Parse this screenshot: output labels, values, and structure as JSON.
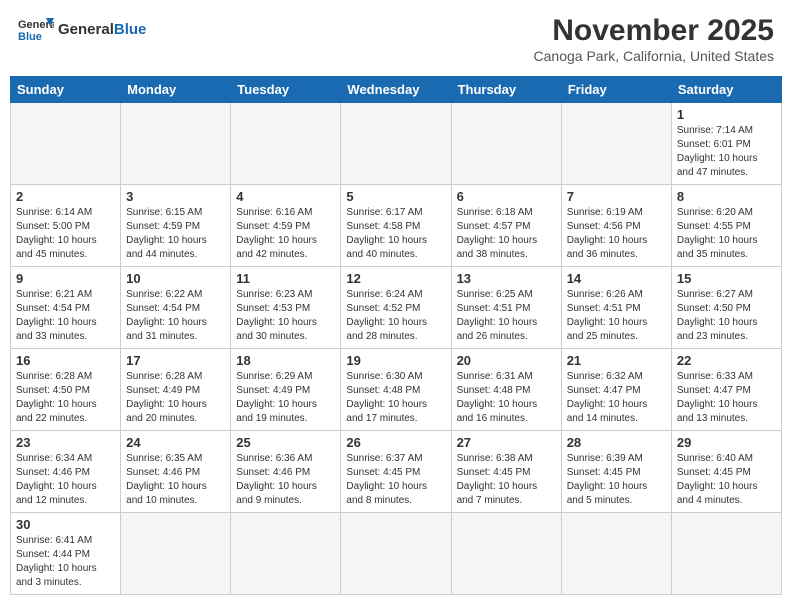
{
  "header": {
    "logo_general": "General",
    "logo_blue": "Blue",
    "month": "November 2025",
    "location": "Canoga Park, California, United States"
  },
  "days_of_week": [
    "Sunday",
    "Monday",
    "Tuesday",
    "Wednesday",
    "Thursday",
    "Friday",
    "Saturday"
  ],
  "weeks": [
    [
      {
        "day": "",
        "info": ""
      },
      {
        "day": "",
        "info": ""
      },
      {
        "day": "",
        "info": ""
      },
      {
        "day": "",
        "info": ""
      },
      {
        "day": "",
        "info": ""
      },
      {
        "day": "",
        "info": ""
      },
      {
        "day": "1",
        "info": "Sunrise: 7:14 AM\nSunset: 6:01 PM\nDaylight: 10 hours and 47 minutes."
      }
    ],
    [
      {
        "day": "2",
        "info": "Sunrise: 6:14 AM\nSunset: 5:00 PM\nDaylight: 10 hours and 45 minutes."
      },
      {
        "day": "3",
        "info": "Sunrise: 6:15 AM\nSunset: 4:59 PM\nDaylight: 10 hours and 44 minutes."
      },
      {
        "day": "4",
        "info": "Sunrise: 6:16 AM\nSunset: 4:59 PM\nDaylight: 10 hours and 42 minutes."
      },
      {
        "day": "5",
        "info": "Sunrise: 6:17 AM\nSunset: 4:58 PM\nDaylight: 10 hours and 40 minutes."
      },
      {
        "day": "6",
        "info": "Sunrise: 6:18 AM\nSunset: 4:57 PM\nDaylight: 10 hours and 38 minutes."
      },
      {
        "day": "7",
        "info": "Sunrise: 6:19 AM\nSunset: 4:56 PM\nDaylight: 10 hours and 36 minutes."
      },
      {
        "day": "8",
        "info": "Sunrise: 6:20 AM\nSunset: 4:55 PM\nDaylight: 10 hours and 35 minutes."
      }
    ],
    [
      {
        "day": "9",
        "info": "Sunrise: 6:21 AM\nSunset: 4:54 PM\nDaylight: 10 hours and 33 minutes."
      },
      {
        "day": "10",
        "info": "Sunrise: 6:22 AM\nSunset: 4:54 PM\nDaylight: 10 hours and 31 minutes."
      },
      {
        "day": "11",
        "info": "Sunrise: 6:23 AM\nSunset: 4:53 PM\nDaylight: 10 hours and 30 minutes."
      },
      {
        "day": "12",
        "info": "Sunrise: 6:24 AM\nSunset: 4:52 PM\nDaylight: 10 hours and 28 minutes."
      },
      {
        "day": "13",
        "info": "Sunrise: 6:25 AM\nSunset: 4:51 PM\nDaylight: 10 hours and 26 minutes."
      },
      {
        "day": "14",
        "info": "Sunrise: 6:26 AM\nSunset: 4:51 PM\nDaylight: 10 hours and 25 minutes."
      },
      {
        "day": "15",
        "info": "Sunrise: 6:27 AM\nSunset: 4:50 PM\nDaylight: 10 hours and 23 minutes."
      }
    ],
    [
      {
        "day": "16",
        "info": "Sunrise: 6:28 AM\nSunset: 4:50 PM\nDaylight: 10 hours and 22 minutes."
      },
      {
        "day": "17",
        "info": "Sunrise: 6:28 AM\nSunset: 4:49 PM\nDaylight: 10 hours and 20 minutes."
      },
      {
        "day": "18",
        "info": "Sunrise: 6:29 AM\nSunset: 4:49 PM\nDaylight: 10 hours and 19 minutes."
      },
      {
        "day": "19",
        "info": "Sunrise: 6:30 AM\nSunset: 4:48 PM\nDaylight: 10 hours and 17 minutes."
      },
      {
        "day": "20",
        "info": "Sunrise: 6:31 AM\nSunset: 4:48 PM\nDaylight: 10 hours and 16 minutes."
      },
      {
        "day": "21",
        "info": "Sunrise: 6:32 AM\nSunset: 4:47 PM\nDaylight: 10 hours and 14 minutes."
      },
      {
        "day": "22",
        "info": "Sunrise: 6:33 AM\nSunset: 4:47 PM\nDaylight: 10 hours and 13 minutes."
      }
    ],
    [
      {
        "day": "23",
        "info": "Sunrise: 6:34 AM\nSunset: 4:46 PM\nDaylight: 10 hours and 12 minutes."
      },
      {
        "day": "24",
        "info": "Sunrise: 6:35 AM\nSunset: 4:46 PM\nDaylight: 10 hours and 10 minutes."
      },
      {
        "day": "25",
        "info": "Sunrise: 6:36 AM\nSunset: 4:46 PM\nDaylight: 10 hours and 9 minutes."
      },
      {
        "day": "26",
        "info": "Sunrise: 6:37 AM\nSunset: 4:45 PM\nDaylight: 10 hours and 8 minutes."
      },
      {
        "day": "27",
        "info": "Sunrise: 6:38 AM\nSunset: 4:45 PM\nDaylight: 10 hours and 7 minutes."
      },
      {
        "day": "28",
        "info": "Sunrise: 6:39 AM\nSunset: 4:45 PM\nDaylight: 10 hours and 5 minutes."
      },
      {
        "day": "29",
        "info": "Sunrise: 6:40 AM\nSunset: 4:45 PM\nDaylight: 10 hours and 4 minutes."
      }
    ],
    [
      {
        "day": "30",
        "info": "Sunrise: 6:41 AM\nSunset: 4:44 PM\nDaylight: 10 hours and 3 minutes."
      },
      {
        "day": "",
        "info": ""
      },
      {
        "day": "",
        "info": ""
      },
      {
        "day": "",
        "info": ""
      },
      {
        "day": "",
        "info": ""
      },
      {
        "day": "",
        "info": ""
      },
      {
        "day": "",
        "info": ""
      }
    ]
  ]
}
